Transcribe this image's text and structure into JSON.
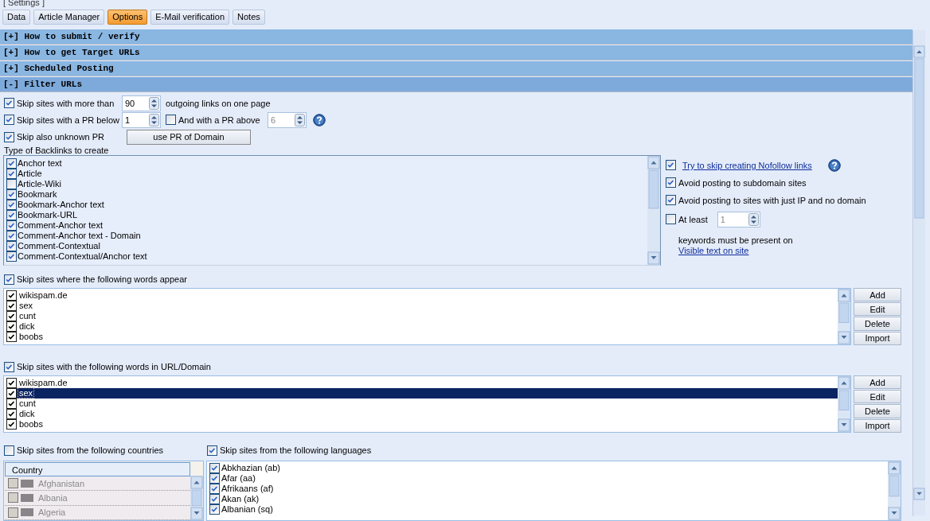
{
  "settings_title": "[ Settings ]",
  "tabs": [
    {
      "label": "Data",
      "selected": false
    },
    {
      "label": "Article Manager",
      "selected": false
    },
    {
      "label": "Options",
      "selected": true
    },
    {
      "label": "E-Mail verification",
      "selected": false
    },
    {
      "label": "Notes",
      "selected": false
    }
  ],
  "sections": [
    {
      "label": "[+] How to submit / verify",
      "expanded": false
    },
    {
      "label": "[+] How to get Target URLs",
      "expanded": false
    },
    {
      "label": "[+] Scheduled Posting",
      "expanded": false
    },
    {
      "label": "[-] Filter URLs",
      "expanded": true
    }
  ],
  "filter": {
    "max_links": {
      "label": "Skip sites with more than",
      "checked": true,
      "value": "90",
      "suffix": "outgoing links on one page"
    },
    "pr_below": {
      "label": "Skip sites with a PR below",
      "checked": true,
      "value": "1"
    },
    "pr_above": {
      "label": "And with a PR above",
      "checked": false,
      "value": "6",
      "disabled": true,
      "help": true
    },
    "unknown_pr": {
      "label": "Skip also unknown PR",
      "checked": true
    },
    "pr_domain_button": "use PR of Domain",
    "backlink_types": {
      "label": "Type of Backlinks to create",
      "items": [
        {
          "label": "Anchor text",
          "checked": true
        },
        {
          "label": "Article",
          "checked": true
        },
        {
          "label": "Article-Wiki",
          "checked": false
        },
        {
          "label": "Bookmark",
          "checked": true
        },
        {
          "label": "Bookmark-Anchor text",
          "checked": true
        },
        {
          "label": "Bookmark-URL",
          "checked": true
        },
        {
          "label": "Comment-Anchor text",
          "checked": true
        },
        {
          "label": "Comment-Anchor text - Domain",
          "checked": true
        },
        {
          "label": "Comment-Contextual",
          "checked": true
        },
        {
          "label": "Comment-Contextual/Anchor text",
          "checked": true
        }
      ]
    },
    "options": [
      {
        "kind": "link",
        "label": "Try to skip creating Nofollow links",
        "checked": true,
        "help": true
      },
      {
        "kind": "plain",
        "label": "Avoid posting to subdomain sites",
        "checked": true,
        "help": false
      },
      {
        "kind": "plain",
        "label": "Avoid posting to sites with just IP and no domain",
        "checked": true,
        "help": false
      }
    ],
    "at_least": {
      "label": "At least",
      "checked": false,
      "value": "1",
      "disabled": true,
      "text": "keywords must be present on",
      "link": "Visible text on site"
    },
    "word_lists": [
      {
        "label": "Skip sites where the following words appear",
        "checked": true,
        "items": [
          {
            "label": "wikispam.de",
            "checked": true,
            "selected": false
          },
          {
            "label": "sex",
            "checked": true,
            "selected": false
          },
          {
            "label": "cunt",
            "checked": true,
            "selected": false
          },
          {
            "label": "dick",
            "checked": true,
            "selected": false
          },
          {
            "label": "boobs",
            "checked": true,
            "selected": false
          }
        ],
        "buttons": [
          "Add",
          "Edit",
          "Delete",
          "Import"
        ]
      },
      {
        "label": "Skip sites with the following words in URL/Domain",
        "checked": true,
        "items": [
          {
            "label": "wikispam.de",
            "checked": true,
            "selected": false
          },
          {
            "label": "sex",
            "checked": true,
            "selected": true
          },
          {
            "label": "cunt",
            "checked": true,
            "selected": false
          },
          {
            "label": "dick",
            "checked": true,
            "selected": false
          },
          {
            "label": "boobs",
            "checked": true,
            "selected": false
          }
        ],
        "buttons": [
          "Add",
          "Edit",
          "Delete",
          "Import"
        ]
      }
    ],
    "countries": {
      "label": "Skip sites from the following countries",
      "checked": false,
      "disabled": true,
      "header": "Country",
      "items": [
        {
          "label": "Afghanistan",
          "checked": false
        },
        {
          "label": "Albania",
          "checked": false
        },
        {
          "label": "Algeria",
          "checked": false
        }
      ]
    },
    "languages": {
      "label": "Skip sites from the following languages",
      "checked": true,
      "items": [
        {
          "label": "Abkhazian (ab)",
          "checked": true
        },
        {
          "label": "Afar (aa)",
          "checked": true
        },
        {
          "label": "Afrikaans (af)",
          "checked": true
        },
        {
          "label": "Akan (ak)",
          "checked": true
        },
        {
          "label": "Albanian (sq)",
          "checked": true
        }
      ]
    }
  }
}
